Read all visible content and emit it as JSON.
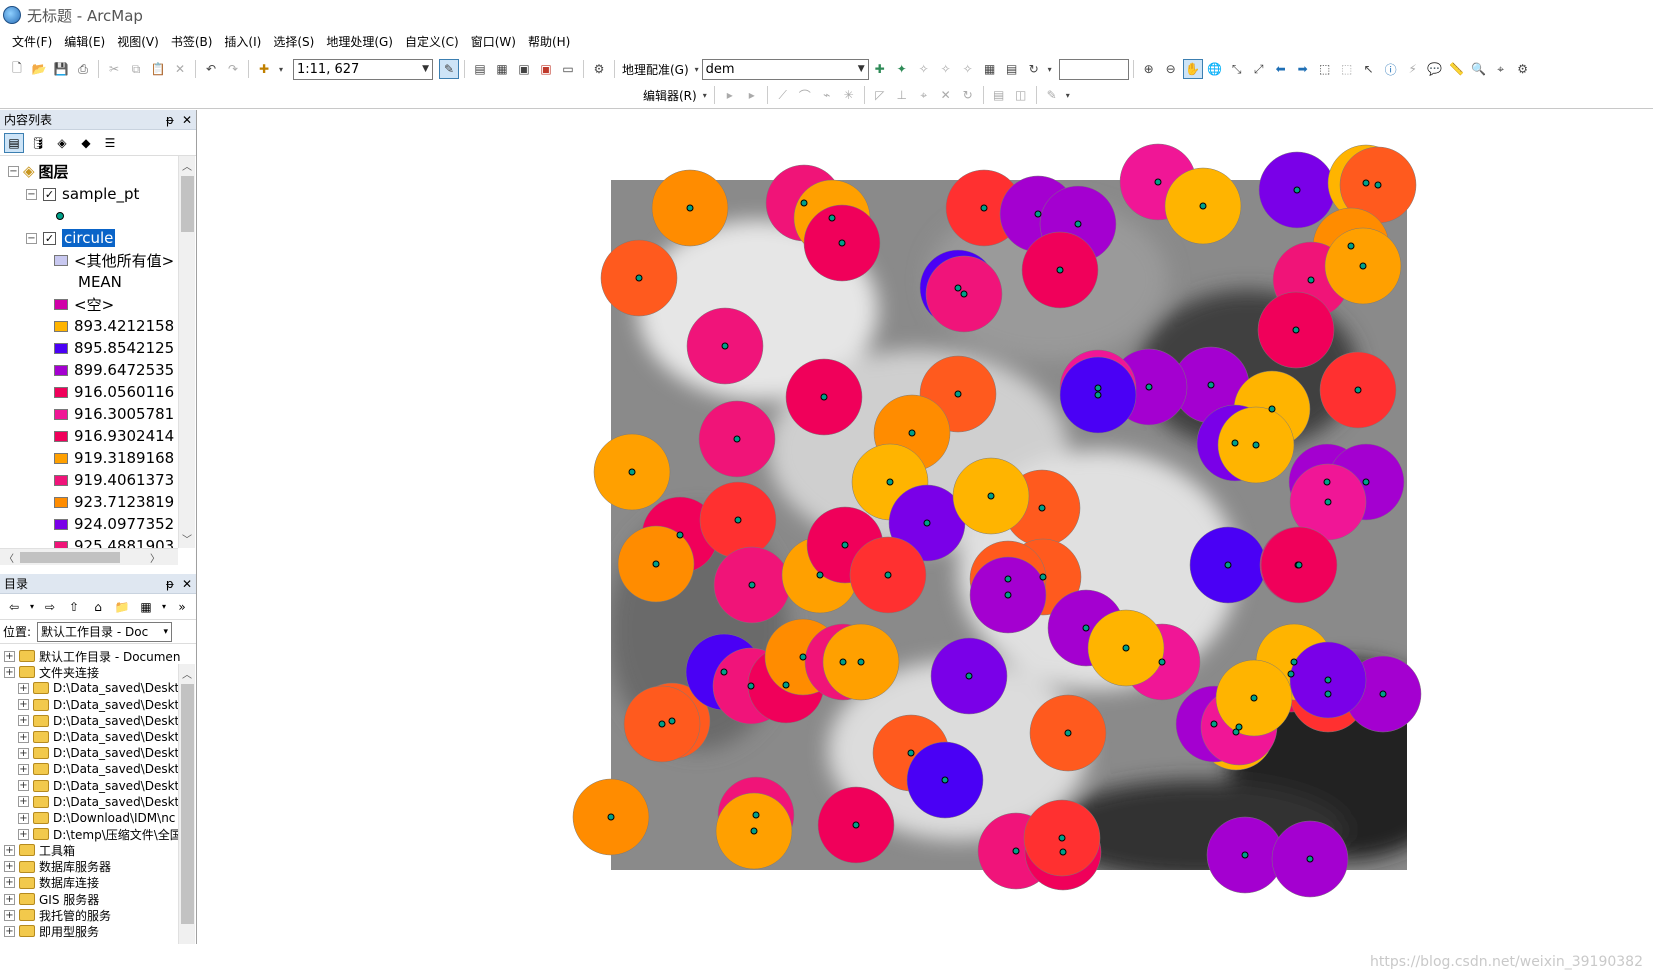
{
  "window": {
    "title": "无标题 - ArcMap"
  },
  "menu": [
    "文件(F)",
    "编辑(E)",
    "视图(V)",
    "书签(B)",
    "插入(I)",
    "选择(S)",
    "地理处理(G)",
    "自定义(C)",
    "窗口(W)",
    "帮助(H)"
  ],
  "toolbar": {
    "scale_value": "1:11, 627",
    "georef_label": "地理配准(G)",
    "layer_combo": "dem",
    "editor_label": "编辑器(R)"
  },
  "toc": {
    "header": "内容列表",
    "pin": "ᵽ",
    "close": "✕",
    "root_label": "图层",
    "layer1": "sample_pt",
    "layer2": "circule",
    "other_values": "<其他所有值>",
    "field_name": "MEAN",
    "null_label": "<空>",
    "legend": [
      {
        "label": "893.4212158",
        "color": "#ffb400"
      },
      {
        "label": "895.8542125",
        "color": "#4a00f5"
      },
      {
        "label": "899.6472535",
        "color": "#a400d0"
      },
      {
        "label": "916.0560116",
        "color": "#f0005a"
      },
      {
        "label": "916.3005781",
        "color": "#f01696"
      },
      {
        "label": "916.9302414",
        "color": "#f0005a"
      },
      {
        "label": "919.3189168",
        "color": "#ffa000"
      },
      {
        "label": "919.4061373",
        "color": "#f0147a"
      },
      {
        "label": "923.7123819",
        "color": "#ff8c00"
      },
      {
        "label": "924.0977352",
        "color": "#7a00e8"
      },
      {
        "label": "925.4881903",
        "color": "#f01478"
      }
    ],
    "other_color": "#c8c8f0",
    "null_color": "#d000a8"
  },
  "catalog": {
    "header": "目录",
    "location_label": "位置:",
    "location_value": "默认工作目录 - Doc",
    "items": [
      "默认工作目录 - Documen",
      "文件夹连接",
      "D:\\Data_saved\\Deskt",
      "D:\\Data_saved\\Deskt",
      "D:\\Data_saved\\Deskt",
      "D:\\Data_saved\\Deskt",
      "D:\\Data_saved\\Deskt",
      "D:\\Data_saved\\Deskt",
      "D:\\Data_saved\\Deskt",
      "D:\\Data_saved\\Deskt",
      "D:\\Download\\IDM\\nc",
      "D:\\temp\\压缩文件\\全国",
      "工具箱",
      "数据库服务器",
      "数据库连接",
      "GIS 服务器",
      "我托管的服务",
      "即用型服务"
    ]
  },
  "map": {
    "circles": [
      {
        "c": "#ff8c00"
      },
      {
        "c": "#f01696"
      },
      {
        "c": "#f0147a"
      },
      {
        "c": "#a400d0"
      },
      {
        "c": "#ff5a1e"
      },
      {
        "c": "#f0005a"
      },
      {
        "c": "#ffb400"
      },
      {
        "c": "#f01478"
      },
      {
        "c": "#ffb400"
      },
      {
        "c": "#f0005a"
      },
      {
        "c": "#a400d0"
      },
      {
        "c": "#4a00f5"
      }
    ],
    "watermark": "https://blog.csdn.net/weixin_39190382"
  }
}
